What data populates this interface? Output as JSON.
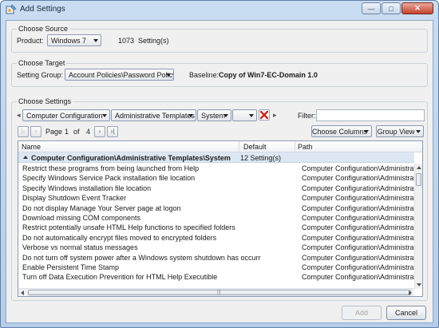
{
  "window": {
    "title": "Add Settings",
    "controls": [
      "minimize",
      "maximize",
      "close"
    ]
  },
  "choose_source": {
    "label": "Choose Source",
    "product_label": "Product:",
    "product_value": "Windows 7",
    "count": "1073",
    "count_label": "Setting(s)"
  },
  "choose_target": {
    "label": "Choose Target",
    "setting_group_label": "Setting Group:",
    "setting_group_value": "Account Policies\\Password Policy",
    "baseline_label": "Baseline:",
    "baseline_value": "Copy of Win7-EC-Domain 1.0"
  },
  "choose_settings": {
    "label": "Choose Settings",
    "breadcrumb": [
      "Computer Configuration",
      "Administrative Templates",
      "System",
      ""
    ],
    "filter_label": "Filter:",
    "filter_value": "",
    "page_label": "Page",
    "page_current": "1",
    "page_of": "of",
    "page_total": "4",
    "choose_columns": "Choose Columns",
    "group_view": "Group View",
    "columns": {
      "name": "Name",
      "default": "Default",
      "path": "Path"
    },
    "group": {
      "name": "Computer Configuration\\Administrative Templates\\System",
      "count": "12 Setting(s)"
    },
    "rows": [
      {
        "name": "Restrict these programs from being launched from Help",
        "path": "Computer Configuration\\Administrat"
      },
      {
        "name": "Specify Windows Service Pack installation file location",
        "path": "Computer Configuration\\Administrat"
      },
      {
        "name": "Specify Windows installation file location",
        "path": "Computer Configuration\\Administrat"
      },
      {
        "name": "Display Shutdown Event Tracker",
        "path": "Computer Configuration\\Administrat"
      },
      {
        "name": "Do not display Manage Your Server page at logon",
        "path": "Computer Configuration\\Administrat"
      },
      {
        "name": "Download missing COM components",
        "path": "Computer Configuration\\Administrat"
      },
      {
        "name": "Restrict potentially unsafe HTML Help functions to specified folders",
        "path": "Computer Configuration\\Administrat"
      },
      {
        "name": "Do not automatically encrypt files moved to encrypted folders",
        "path": "Computer Configuration\\Administrat"
      },
      {
        "name": "Verbose vs normal status messages",
        "path": "Computer Configuration\\Administrat"
      },
      {
        "name": "Do not turn off system power after a Windows system shutdown has occurr",
        "path": "Computer Configuration\\Administrat"
      },
      {
        "name": "Enable Persistent Time Stamp",
        "path": "Computer Configuration\\Administrat"
      },
      {
        "name": "Turn off Data Execution Prevention for HTML Help Executible",
        "path": "Computer Configuration\\Administrat"
      }
    ]
  },
  "buttons": {
    "add": "Add",
    "cancel": "Cancel"
  }
}
